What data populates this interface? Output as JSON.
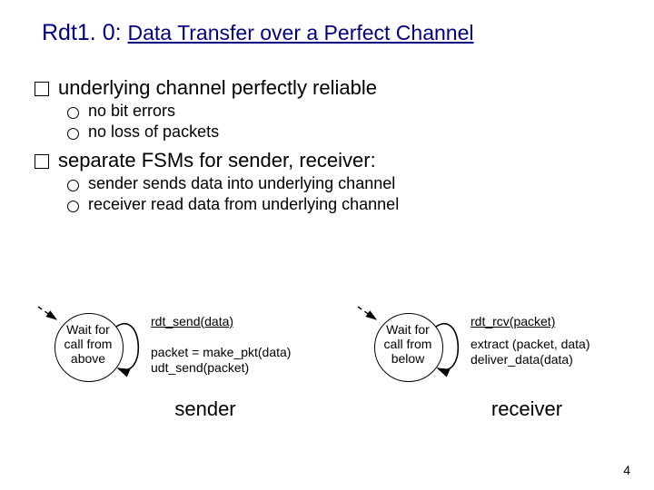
{
  "title": {
    "lead": "Rdt1. 0:",
    "sub": "Data Transfer over a Perfect Channel"
  },
  "bullets": {
    "p1": "underlying channel perfectly reliable",
    "p1a": "no bit errors",
    "p1b": "no loss of packets",
    "p2": "separate FSMs for sender, receiver:",
    "p2a": "sender sends data into underlying channel",
    "p2b": "receiver read data from underlying channel"
  },
  "sender": {
    "state": "Wait for\ncall from\nabove",
    "event": "rdt_send(data)",
    "action1": "packet = make_pkt(data)",
    "action2": "udt_send(packet)",
    "role": "sender"
  },
  "receiver": {
    "state": "Wait for\ncall from\nbelow",
    "event": "rdt_rcv(packet)",
    "action1": "extract (packet, data)",
    "action2": "deliver_data(data)",
    "role": "receiver"
  },
  "page": "4"
}
